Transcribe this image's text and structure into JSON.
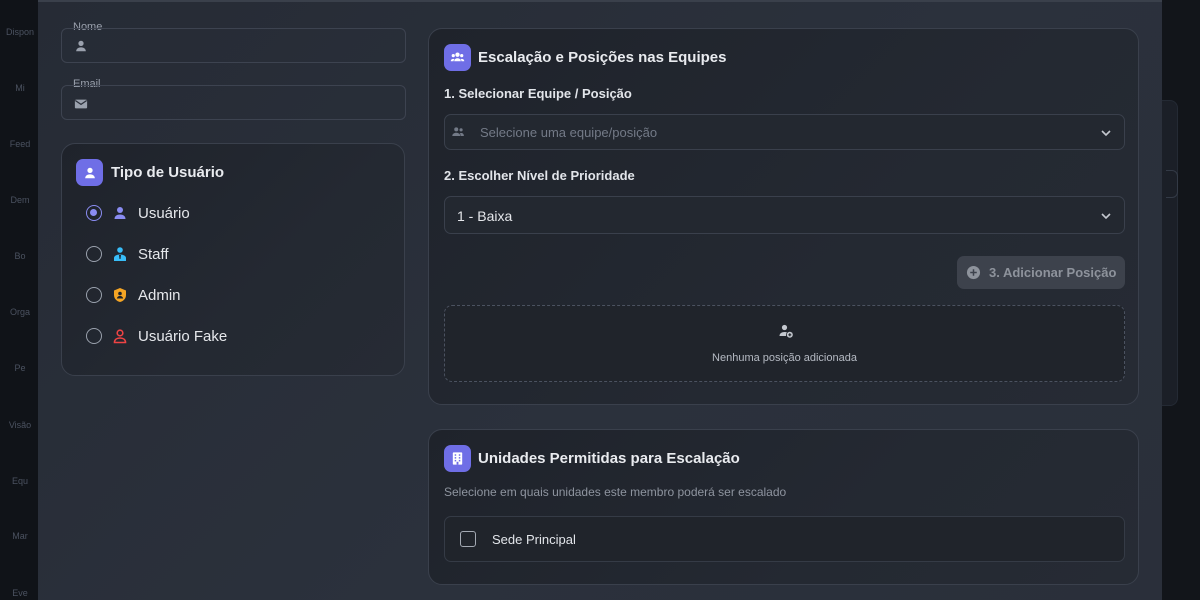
{
  "background": {
    "sidebar_items": [
      "Dispon",
      "Mi",
      "Feed",
      "Dem",
      "Bo",
      "Orga",
      "Pe",
      "Visão",
      "Equ",
      "Mar",
      "Eve"
    ]
  },
  "form": {
    "name_field": {
      "label": "Nome",
      "value": "",
      "icon": "person-icon"
    },
    "email_field": {
      "label": "Email",
      "value": "",
      "icon": "mail-icon"
    }
  },
  "user_type": {
    "title": "Tipo de Usuário",
    "options": [
      {
        "label": "Usuário",
        "checked": true,
        "icon": "person-icon",
        "color": "#8a8cf2"
      },
      {
        "label": "Staff",
        "checked": false,
        "icon": "staff-icon",
        "color": "#38bdf8"
      },
      {
        "label": "Admin",
        "checked": false,
        "icon": "admin-shield-icon",
        "color": "#f5a524"
      },
      {
        "label": "Usuário Fake",
        "checked": false,
        "icon": "fake-user-icon",
        "color": "#ef4444"
      }
    ]
  },
  "teams": {
    "title": "Escalação e Posições nas Equipes",
    "step1_label": "1. Selecionar Equipe / Posição",
    "team_select_placeholder": "Selecione uma equipe/posição",
    "step2_label": "2. Escolher Nível de Prioridade",
    "priority_value": "1 - Baixa",
    "add_button_label": "3. Adicionar Posição",
    "empty_text": "Nenhuma posição adicionada"
  },
  "units": {
    "title": "Unidades Permitidas para Escalação",
    "subtitle": "Selecione em quais unidades este membro poderá ser escalado",
    "items": [
      {
        "label": "Sede Principal",
        "checked": false
      }
    ]
  },
  "colors": {
    "accent": "#6f6ee6",
    "modal_bg": "#2a2f3a"
  }
}
